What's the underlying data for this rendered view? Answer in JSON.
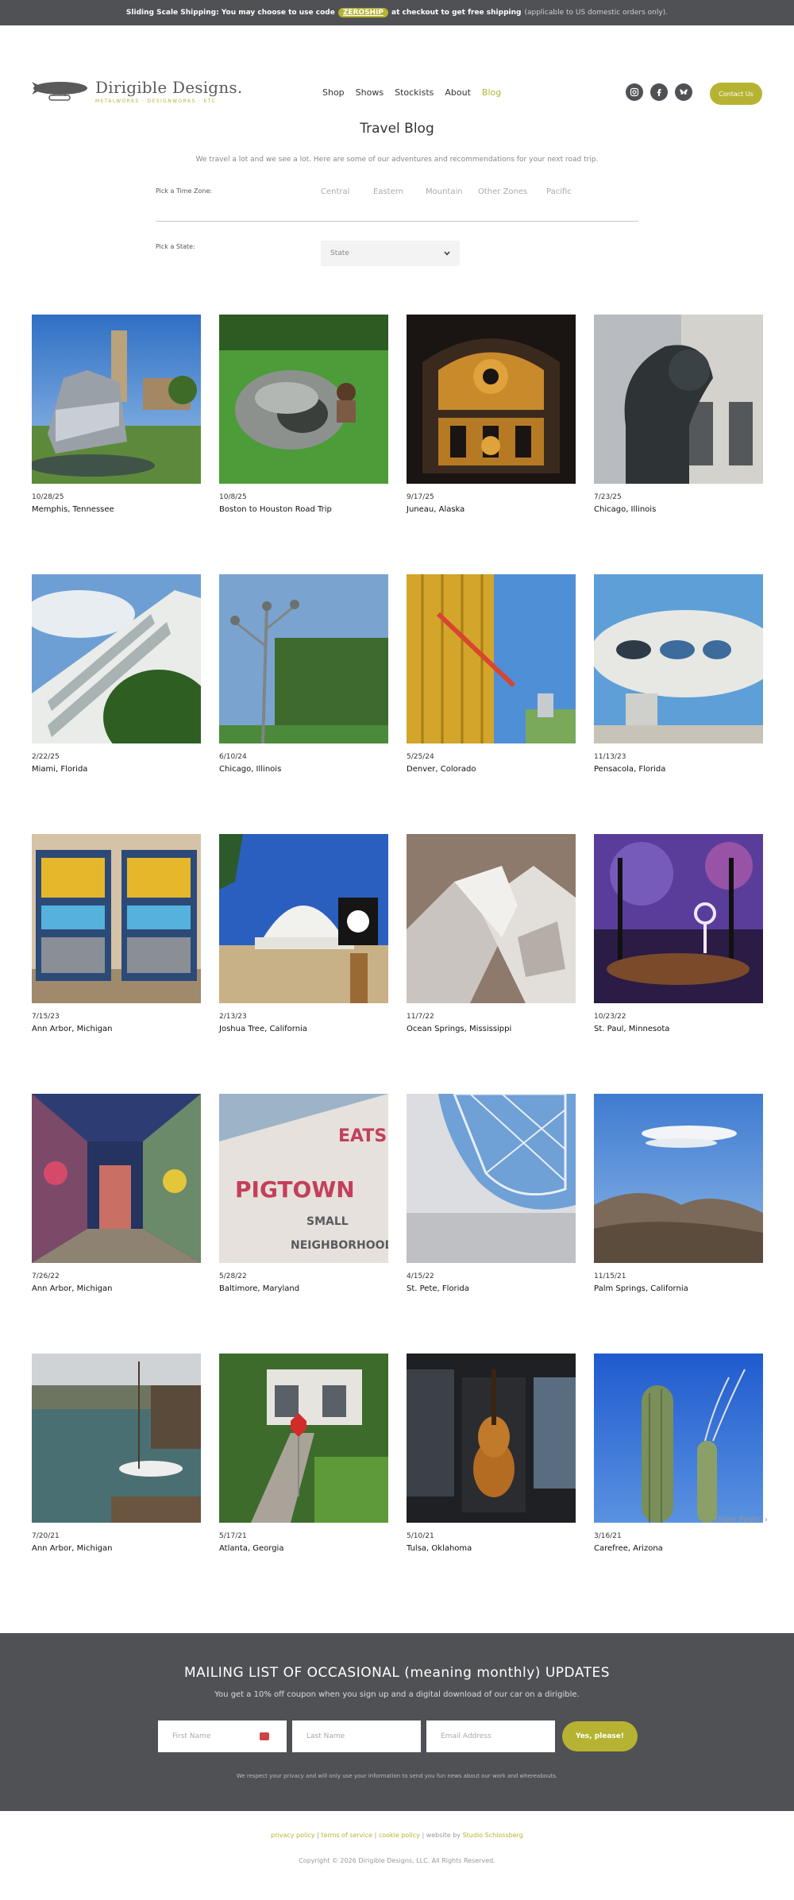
{
  "announcement": {
    "lead": "Sliding Scale Shipping: You may choose to use code",
    "code": "ZEROSHIP",
    "tail": "at checkout to get free shipping",
    "note": "(applicable to US domestic orders only)."
  },
  "brand": {
    "name": "Dirigible Designs.",
    "tagline": "METALWORKS · DESIGNWORKS · ETC"
  },
  "nav": {
    "items": [
      "Shop",
      "Shows",
      "Stockists",
      "About",
      "Blog"
    ],
    "active": "Blog"
  },
  "socials": [
    "instagram-icon",
    "facebook-icon",
    "bluesky-icon"
  ],
  "contact_label": "Contact Us",
  "blog": {
    "title": "Travel Blog",
    "intro": "We travel a lot and we see a lot. Here are some of our adventures and recommendations for your next road trip.",
    "timezone_label": "Pick a Time Zone:",
    "timezones": [
      "Central",
      "Eastern",
      "Mountain",
      "Other Zones",
      "Pacific"
    ],
    "state_label": "Pick a State:",
    "state_placeholder": "State"
  },
  "posts": [
    {
      "date": "10/28/25",
      "place": "Memphis, Tennessee"
    },
    {
      "date": "10/8/25",
      "place": "Boston to Houston Road Trip"
    },
    {
      "date": "9/17/25",
      "place": "Juneau, Alaska"
    },
    {
      "date": "7/23/25",
      "place": "Chicago, Illinois"
    },
    {
      "date": "2/22/25",
      "place": "Miami, Florida"
    },
    {
      "date": "6/10/24",
      "place": "Chicago, Illinois"
    },
    {
      "date": "5/25/24",
      "place": "Denver, Colorado"
    },
    {
      "date": "11/13/23",
      "place": "Pensacola, Florida"
    },
    {
      "date": "7/15/23",
      "place": "Ann Arbor, Michigan"
    },
    {
      "date": "2/13/23",
      "place": "Joshua Tree, California"
    },
    {
      "date": "11/7/22",
      "place": "Ocean Springs, Mississippi"
    },
    {
      "date": "10/23/22",
      "place": "St. Paul, Minnesota"
    },
    {
      "date": "7/26/22",
      "place": "Ann Arbor, Michigan"
    },
    {
      "date": "5/28/22",
      "place": "Baltimore, Maryland"
    },
    {
      "date": "4/15/22",
      "place": "St. Pete, Florida"
    },
    {
      "date": "11/15/21",
      "place": "Palm Springs, California"
    },
    {
      "date": "7/20/21",
      "place": "Ann Arbor, Michigan"
    },
    {
      "date": "5/17/21",
      "place": "Atlanta, Georgia"
    },
    {
      "date": "5/10/21",
      "place": "Tulsa, Oklahoma"
    },
    {
      "date": "3/16/21",
      "place": "Carefree, Arizona"
    }
  ],
  "older_posts": "Older Posts",
  "mailing": {
    "title": "MAILING LIST OF OCCASIONAL (meaning monthly) UPDATES",
    "subtitle": "You get a 10% off coupon when you sign up and a digital download of our car on a dirigible.",
    "first_name": "First Name",
    "last_name": "Last Name",
    "email": "Email Address",
    "button": "Yes, please!",
    "note": "We respect your privacy and will only use your information to send you fun news about our work and whereabouts."
  },
  "footer": {
    "links": [
      "privacy policy",
      "terms of service",
      "cookie policy"
    ],
    "credit_prefix": "website by",
    "credit_name": "Studio Schlossberg",
    "copyright": "Copyright © 2026 Dirigible Designs, LLC. All Rights Reserved."
  },
  "colors": {
    "accent": "#b7b332",
    "dark": "#4f5155"
  }
}
